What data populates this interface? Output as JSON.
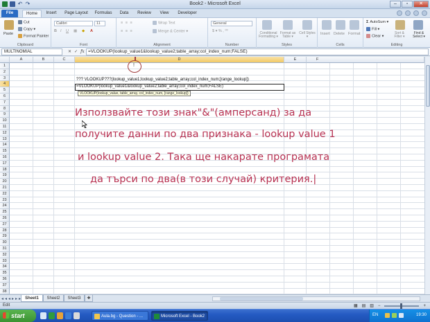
{
  "window": {
    "title": "Book2 - Microsoft Excel"
  },
  "ribbon_tabs": [
    "File",
    "Home",
    "Insert",
    "Page Layout",
    "Formulas",
    "Data",
    "Review",
    "View",
    "Developer"
  ],
  "ribbon": {
    "clipboard": {
      "paste": "Paste",
      "cut": "Cut",
      "copy": "Copy ▾",
      "format_painter": "Format Painter",
      "label": "Clipboard"
    },
    "font": {
      "font_name": "Calibri",
      "font_size": "11",
      "label": "Font"
    },
    "alignment": {
      "wrap_text": "Wrap Text",
      "merge_center": "Merge & Center ▾",
      "label": "Alignment"
    },
    "number": {
      "format": "General",
      "label": "Number"
    },
    "styles": {
      "conditional": "Conditional Formatting ▾",
      "format_table": "Format as Table ▾",
      "cell_styles": "Cell Styles ▾",
      "label": "Styles"
    },
    "cells": {
      "insert": "Insert",
      "delete": "Delete",
      "format": "Format",
      "label": "Cells"
    },
    "editing": {
      "autosum": "AutoSum ▾",
      "fill": "Fill ▾",
      "clear": "Clear ▾",
      "sort_filter": "Sort & Filter ▾",
      "find_select": "Find & Select ▾",
      "label": "Editing"
    }
  },
  "formula_bar": {
    "name_box": "MULTINOMIAL",
    "formula": "=VLOOKUP(lookup_value1&lookup_value2;table_array;col_index_num;FALSE)"
  },
  "grid": {
    "columns": [
      "A",
      "B",
      "C",
      "D",
      "E",
      "F"
    ],
    "rows": [
      "1",
      "2",
      "3",
      "4",
      "5",
      "6",
      "7",
      "8",
      "9",
      "10",
      "11",
      "12",
      "13",
      "14",
      "15",
      "16",
      "17",
      "18",
      "19",
      "20",
      "21",
      "22",
      "23",
      "24",
      "25",
      "26",
      "27",
      "28",
      "29",
      "30",
      "31",
      "32",
      "33",
      "34",
      "35",
      "36",
      "37",
      "38"
    ],
    "selected_column": "D",
    "selected_row": "4",
    "d3": "??? VLOOKUP???(lookup_value1;lookup_value2;table_array;col_index_num;[range_lookup])",
    "d4": "=VLOOKUP(lookup_value1&lookup_value2;table_array;col_index_num;FALSE)",
    "tooltip": "VLOOKUP(lookup_value, table_array, col_index_num, [range_lookup])"
  },
  "annotation": {
    "marker": "!",
    "lines": [
      "Използвайте този знак\"&\"(амперсанд) за да",
      "получите данни по два признака - lookup value 1",
      "и    lookup value 2. Така ще накарате програмата",
      "да търси по два(в този случай) критерия.|"
    ]
  },
  "sheets": [
    "Sheet1",
    "Sheet2",
    "Sheet3"
  ],
  "active_sheet": "Sheet1",
  "status": {
    "mode": "Edit"
  },
  "taskbar": {
    "start": "start",
    "tasks": [
      "Aula.bg - Question - ...",
      "Microsoft Excel - Book2"
    ],
    "language": "EN",
    "clock": "19:30"
  },
  "colors": {
    "accent": "#2b6cc4",
    "annotation_text": "#b83252",
    "marker": "#a03a3a"
  }
}
